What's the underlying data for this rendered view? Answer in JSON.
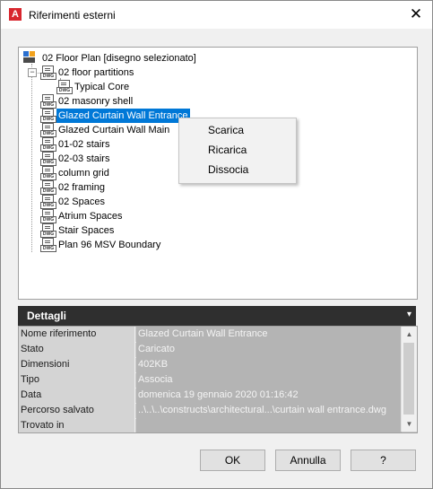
{
  "window": {
    "title": "Riferimenti esterni",
    "app_icon_letter": "A",
    "close_glyph": "✕"
  },
  "tree": {
    "root": "02 Floor Plan [disegno selezionato]",
    "file_tag": "DWG",
    "expander_glyph": "−",
    "items": [
      {
        "label": "02 floor partitions"
      },
      {
        "label": "Typical Core"
      },
      {
        "label": "02 masonry shell"
      },
      {
        "label": "Glazed Curtain Wall Entrance"
      },
      {
        "label": "Glazed Curtain Wall Main"
      },
      {
        "label": "01-02 stairs"
      },
      {
        "label": "02-03 stairs"
      },
      {
        "label": "column grid"
      },
      {
        "label": "02 framing"
      },
      {
        "label": "02 Spaces"
      },
      {
        "label": "Atrium Spaces"
      },
      {
        "label": "Stair Spaces"
      },
      {
        "label": "Plan 96 MSV Boundary"
      }
    ]
  },
  "context_menu": {
    "items": [
      "Scarica",
      "Ricarica",
      "Dissocia"
    ]
  },
  "details": {
    "title": "Dettagli",
    "toggle_glyph": "▾",
    "rows": [
      {
        "key": "Nome riferimento",
        "value": "Glazed Curtain Wall Entrance"
      },
      {
        "key": "Stato",
        "value": "Caricato"
      },
      {
        "key": "Dimensioni",
        "value": "402KB"
      },
      {
        "key": "Tipo",
        "value": "Associa"
      },
      {
        "key": "Data",
        "value": "domenica 19 gennaio 2020  01:16:42"
      },
      {
        "key": "Percorso salvato",
        "value": "..\\..\\..\\constructs\\architectural...\\curtain wall entrance.dwg"
      },
      {
        "key": "Trovato in",
        "value": ""
      }
    ],
    "scroll_up_glyph": "▲",
    "scroll_down_glyph": "▼"
  },
  "buttons": {
    "ok": "OK",
    "cancel": "Annulla",
    "help": "?"
  },
  "colors": {
    "selection": "#0078d7",
    "details_header": "#2f2f2f",
    "app_icon": "#d8262e"
  }
}
